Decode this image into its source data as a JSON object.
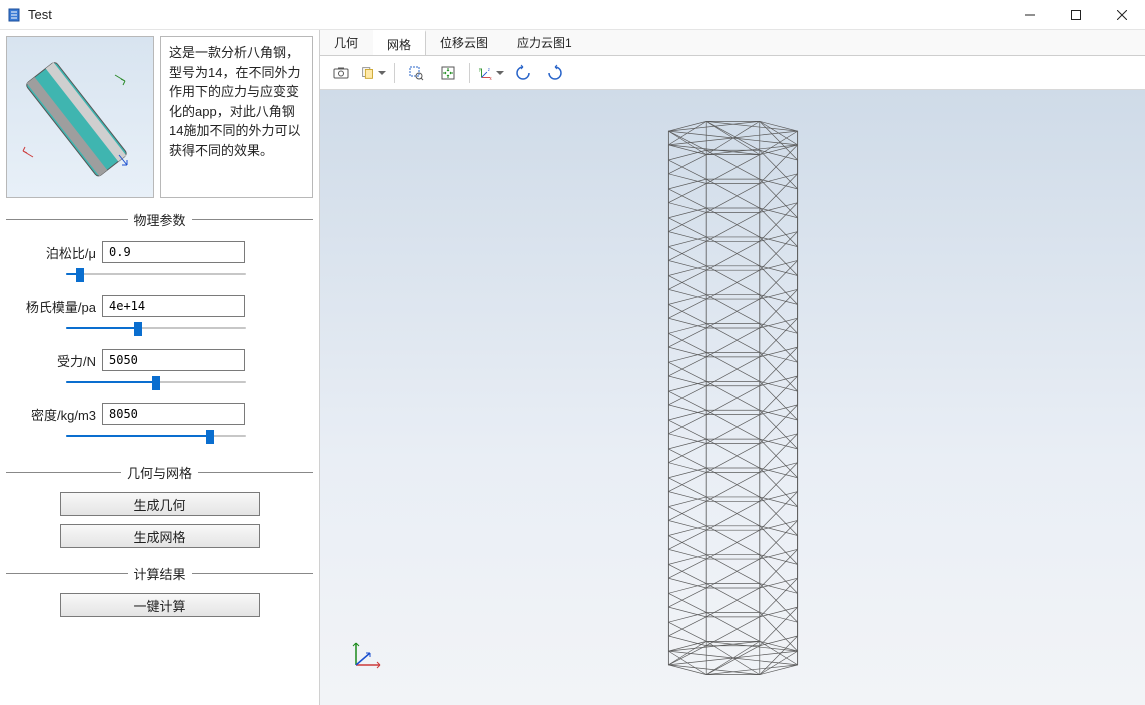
{
  "window": {
    "title": "Test"
  },
  "description": "这是一款分析八角钢，型号为14，在不同外力作用下的应力与应变变化的app，对此八角钢14施加不同的外力可以获得不同的效果。",
  "sections": {
    "params": "物理参数",
    "geomesh": "几何与网格",
    "results": "计算结果"
  },
  "params": {
    "poisson": {
      "label": "泊松比/μ",
      "value": "0.9",
      "slider_percent": 8
    },
    "youngs": {
      "label": "杨氏模量/pa",
      "value": "4e+14",
      "slider_percent": 40
    },
    "force": {
      "label": "受力/N",
      "value": "5050",
      "slider_percent": 50
    },
    "density": {
      "label": "密度/kg/m3",
      "value": "8050",
      "slider_percent": 80
    }
  },
  "buttons": {
    "gen_geometry": "生成几何",
    "gen_mesh": "生成网格",
    "compute": "一键计算"
  },
  "tabs": [
    {
      "key": "geom",
      "label": "几何",
      "active": false
    },
    {
      "key": "mesh",
      "label": "网格",
      "active": true
    },
    {
      "key": "disp",
      "label": "位移云图",
      "active": false
    },
    {
      "key": "stress1",
      "label": "应力云图1",
      "active": false
    }
  ],
  "toolbar_icons": {
    "screenshot": "screenshot-icon",
    "copy": "copy-icon",
    "zoom_box": "zoom-box-icon",
    "fit": "fit-icon",
    "axes": "axes-icon",
    "rotate_ccw": "rotate-ccw-icon",
    "rotate_cw": "rotate-cw-icon"
  }
}
